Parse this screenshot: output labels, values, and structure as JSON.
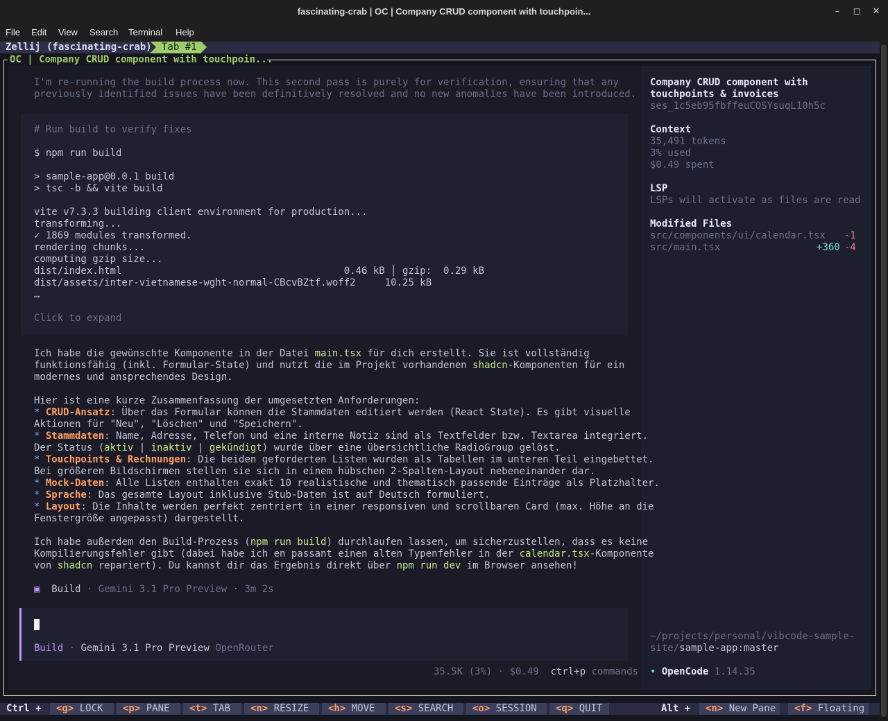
{
  "window": {
    "title": "fascinating-crab | OC | Company CRUD component with touchpoin...",
    "minimize_icon": "minimize-icon",
    "maximize_icon": "maximize-icon",
    "close_icon": "close-icon"
  },
  "menu": [
    "File",
    "Edit",
    "View",
    "Search",
    "Terminal",
    "Help"
  ],
  "zellij": {
    "session": "Zellij (fascinating-crab)",
    "tab": "Tab #1",
    "pane_title": "OC | Company CRUD component with touchpoin..."
  },
  "chat": {
    "thinking": [
      "I'm re-running the build process now. This second pass is purely for verification, ensuring that any",
      "previously identified issues have been definitively resolved and no new anomalies have been introduced."
    ],
    "tool": {
      "comment": "# Run build to verify fixes",
      "command": "$ npm run build",
      "output": [
        "> sample-app@0.0.1 build",
        "> tsc -b && vite build",
        "",
        "vite v7.3.3 building client environment for production...",
        "transforming...",
        "✓ 1869 modules transformed.",
        "rendering chunks...",
        "computing gzip size...",
        "dist/index.html                                      0.46 kB │ gzip:  0.29 kB",
        "dist/assets/inter-vietnamese-wght-normal-CBcvBZtf.woff2     10.25 kB",
        "…"
      ],
      "expand": "Click to expand"
    },
    "response": {
      "p1_a": "Ich habe die gewünschte Komponente in der Datei ",
      "p1_file": "main.tsx",
      "p1_b": " für dich erstellt. Sie ist vollständig",
      "p1_line2a": "funktionsfähig (inkl. Formular-State) und nutzt die im Projekt vorhandenen ",
      "p1_shadcn": "shadcn",
      "p1_line2b": "-Komponenten für ein",
      "p1_line3": "modernes und ansprechendes Design.",
      "p2": "Hier ist eine kurze Zusammenfassung der umgesetzten Anforderungen:",
      "bullets": [
        {
          "key": "CRUD-Ansatz",
          "text": ": Über das Formular können die Stammdaten editiert werden (React State). Es gibt visuelle",
          "cont": "Aktionen für \"Neu\", \"Löschen\" und \"Speichern\"."
        },
        {
          "key": "Stammdaten",
          "text": ": Name, Adresse, Telefon und eine interne Notiz sind als Textfelder bzw. Textarea integriert."
        },
        {
          "key": "Touchpoints & Rechnungen",
          "text": ": Die beiden geforderten Listen wurden als Tabellen im unteren Teil eingebettet.",
          "cont": "Bei größeren Bildschirmen stellen sie sich in einem hübschen 2-Spalten-Layout nebeneinander dar."
        },
        {
          "key": "Mock-Daten",
          "text": ": Alle Listen enthalten exakt 10 realistische und thematisch passende Einträge als Platzhalter."
        },
        {
          "key": "Sprache",
          "text": ": Das gesamte Layout inklusive Stub-Daten ist auf Deutsch formuliert."
        },
        {
          "key": "Layout",
          "text": ": Die Inhalte werden perfekt zentriert in einer responsiven und scrollbaren Card (max. Höhe an die",
          "cont": "Fenstergröße angepasst) dargestellt."
        }
      ],
      "status_line_a": "Der Status (",
      "status_aktiv": "aktiv",
      "status_sep1": " | ",
      "status_inaktiv": "inaktiv",
      "status_sep2": " | ",
      "status_gek": "gekündigt",
      "status_line_b": ") wurde über eine übersichtliche RadioGroup gelöst.",
      "p3_a": "Ich habe außerdem den Build-Prozess (",
      "p3_cmd": "npm run build",
      "p3_b": ") durchlaufen lassen, um sicherzustellen, dass es keine",
      "p3_line2a": "Kompilierungsfehler gibt (dabei habe ich en passant einen alten Typenfehler in der ",
      "p3_cal": "calendar.tsx",
      "p3_line2b": "-Komponente",
      "p3_line3a": "von ",
      "p3_shadcn": "shadcn",
      "p3_line3b": " repariert). Du kannst dir das Ergebnis direkt über ",
      "p3_dev": "npm run dev",
      "p3_line3c": " im Browser ansehen!"
    },
    "footer": {
      "mode": "Build",
      "model": "Gemini 3.1 Pro Preview",
      "duration": "3m 2s",
      "sep": "·"
    }
  },
  "input": {
    "mode": "Build",
    "model": "Gemini 3.1 Pro Preview",
    "provider": "OpenRouter",
    "stats": "35.5K (3%) · $0.49",
    "shortcut_key": "ctrl+p",
    "shortcut_label": "commands"
  },
  "sidebar": {
    "title_l1": "Company CRUD component with",
    "title_l2": "touchpoints & invoices",
    "session_id": "ses_1c5eb95fbffeuCOSYsuqL10h5c",
    "context_heading": "Context",
    "tokens": "35,491 tokens",
    "used": "3% used",
    "spent": "$0.49 spent",
    "lsp_heading": "LSP",
    "lsp_text": "LSPs will activate as files are read",
    "modified_heading": "Modified Files",
    "files": [
      {
        "path": "src/components/ui/calendar.tsx",
        "added": "",
        "removed": "-1"
      },
      {
        "path": "src/main.tsx",
        "added": "+360",
        "removed": "-4"
      }
    ],
    "path_l1": "~/projects/personal/vibcode-sample-",
    "path_l2a": "site/",
    "path_l2b": "sample-app:master",
    "app_dot": "•",
    "app_name": "OpenCode",
    "app_version": "1.14.35"
  },
  "statusbar": {
    "ctrl": "Ctrl +",
    "keys": [
      {
        "k": "<g>",
        "l": "LOCK"
      },
      {
        "k": "<p>",
        "l": "PANE"
      },
      {
        "k": "<t>",
        "l": "TAB"
      },
      {
        "k": "<n>",
        "l": "RESIZE"
      },
      {
        "k": "<h>",
        "l": "MOVE"
      },
      {
        "k": "<s>",
        "l": "SEARCH"
      },
      {
        "k": "<o>",
        "l": "SESSION"
      },
      {
        "k": "<q>",
        "l": "QUIT"
      }
    ],
    "alt": "Alt +",
    "alt_keys": [
      {
        "k": "<n>",
        "l": "New Pane"
      },
      {
        "k": "<f>",
        "l": "Floating"
      }
    ]
  }
}
